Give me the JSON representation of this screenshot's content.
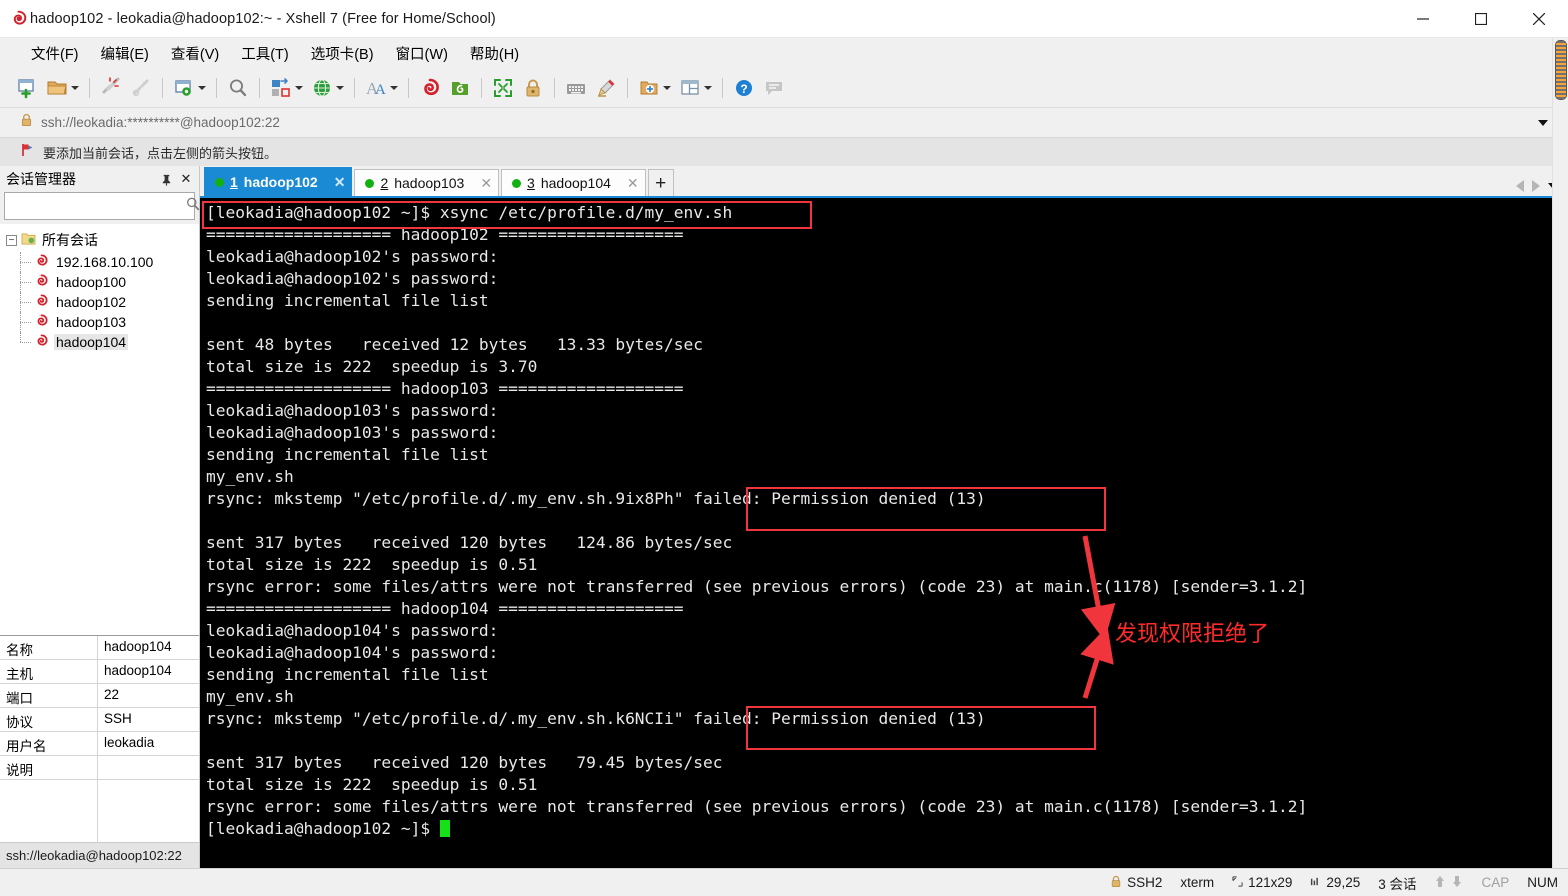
{
  "window": {
    "title": "hadoop102 - leokadia@hadoop102:~ - Xshell 7 (Free for Home/School)",
    "logo_icon": "xshell-logo-icon",
    "minimize_label": "—",
    "maximize_label": "▢",
    "close_label": "✕"
  },
  "menubar": {
    "items": [
      {
        "label": "文件(F)",
        "name": "menu-file"
      },
      {
        "label": "编辑(E)",
        "name": "menu-edit"
      },
      {
        "label": "查看(V)",
        "name": "menu-view"
      },
      {
        "label": "工具(T)",
        "name": "menu-tools"
      },
      {
        "label": "选项卡(B)",
        "name": "menu-tabs"
      },
      {
        "label": "窗口(W)",
        "name": "menu-window"
      },
      {
        "label": "帮助(H)",
        "name": "menu-help"
      }
    ]
  },
  "toolbar": {
    "buttons": [
      {
        "icon": "new-session-icon",
        "has_caret": false
      },
      {
        "icon": "open-folder-icon",
        "has_caret": true
      },
      {
        "icon": "disconnect-icon",
        "has_caret": false
      },
      {
        "icon": "reconnect-icon",
        "has_caret": false
      },
      {
        "icon": "session-properties-icon",
        "has_caret": true
      },
      {
        "icon": "find-icon",
        "has_caret": false
      },
      {
        "icon": "file-transfer-icon",
        "has_caret": true
      },
      {
        "icon": "globe-icon",
        "has_caret": true
      },
      {
        "icon": "font-icon",
        "has_caret": true
      },
      {
        "icon": "xshell-icon",
        "has_caret": false
      },
      {
        "icon": "xftp-icon",
        "has_caret": false
      },
      {
        "icon": "fullscreen-icon",
        "has_caret": false
      },
      {
        "icon": "lock-icon",
        "has_caret": false
      },
      {
        "icon": "keyboard-icon",
        "has_caret": false
      },
      {
        "icon": "highlight-pen-icon",
        "has_caret": false
      },
      {
        "icon": "add-folder-icon",
        "has_caret": true
      },
      {
        "icon": "layout-icon",
        "has_caret": true
      },
      {
        "icon": "help-icon",
        "has_caret": false
      },
      {
        "icon": "comment-icon",
        "has_caret": false
      }
    ]
  },
  "address_bar": {
    "lock_icon": "lock-icon",
    "url": "ssh://leokadia:**********@hadoop102:22",
    "dropdown_icon": "chevron-down-icon"
  },
  "notice_bar": {
    "flag_icon": "red-flag-icon",
    "text": "要添加当前会话，点击左侧的箭头按钮。"
  },
  "sidebar": {
    "title": "会话管理器",
    "pin_icon": "pin-icon",
    "close_icon": "close-icon",
    "search": {
      "value": "",
      "placeholder": "",
      "icon": "search-icon"
    },
    "tree": {
      "root_label": "所有会话",
      "root_icon": "folder-sessions-icon",
      "toggle": "−",
      "items": [
        {
          "label": "192.168.10.100",
          "icon": "session-icon",
          "selected": false
        },
        {
          "label": "hadoop100",
          "icon": "session-icon",
          "selected": false
        },
        {
          "label": "hadoop102",
          "icon": "session-icon",
          "selected": false
        },
        {
          "label": "hadoop103",
          "icon": "session-icon",
          "selected": false
        },
        {
          "label": "hadoop104",
          "icon": "session-icon",
          "selected": true
        }
      ]
    },
    "properties": [
      {
        "key": "名称",
        "value": "hadoop104"
      },
      {
        "key": "主机",
        "value": "hadoop104"
      },
      {
        "key": "端口",
        "value": "22"
      },
      {
        "key": "协议",
        "value": "SSH"
      },
      {
        "key": "用户名",
        "value": "leokadia"
      },
      {
        "key": "说明",
        "value": ""
      }
    ],
    "status": "ssh://leokadia@hadoop102:22"
  },
  "tabs": {
    "items": [
      {
        "num": "1",
        "label": "hadoop102",
        "active": true,
        "status_dot": "#12b112",
        "close_icon": "close-icon"
      },
      {
        "num": "2",
        "label": "hadoop103",
        "active": false,
        "status_dot": "#12b112",
        "close_icon": "close-icon"
      },
      {
        "num": "3",
        "label": "hadoop104",
        "active": false,
        "status_dot": "#12b112",
        "close_icon": "close-icon"
      }
    ],
    "add_label": "+",
    "nav_prev_icon": "triangle-left-icon",
    "nav_next_icon": "triangle-right-icon",
    "nav_list_icon": "chevron-down-icon"
  },
  "terminal": {
    "lines": [
      "[leokadia@hadoop102 ~]$ xsync /etc/profile.d/my_env.sh",
      "=================== hadoop102 ===================",
      "leokadia@hadoop102's password:",
      "leokadia@hadoop102's password:",
      "sending incremental file list",
      "",
      "sent 48 bytes   received 12 bytes   13.33 bytes/sec",
      "total size is 222  speedup is 3.70",
      "=================== hadoop103 ===================",
      "leokadia@hadoop103's password:",
      "leokadia@hadoop103's password:",
      "sending incremental file list",
      "my_env.sh",
      "rsync: mkstemp \"/etc/profile.d/.my_env.sh.9ix8Ph\" failed: Permission denied (13)",
      "",
      "sent 317 bytes   received 120 bytes   124.86 bytes/sec",
      "total size is 222  speedup is 0.51",
      "rsync error: some files/attrs were not transferred (see previous errors) (code 23) at main.c(1178) [sender=3.1.2]",
      "=================== hadoop104 ===================",
      "leokadia@hadoop104's password:",
      "leokadia@hadoop104's password:",
      "sending incremental file list",
      "my_env.sh",
      "rsync: mkstemp \"/etc/profile.d/.my_env.sh.k6NCIi\" failed: Permission denied (13)",
      "",
      "sent 317 bytes   received 120 bytes   79.45 bytes/sec",
      "total size is 222  speedup is 0.51",
      "rsync error: some files/attrs were not transferred (see previous errors) (code 23) at main.c(1178) [sender=3.1.2]",
      "[leokadia@hadoop102 ~]$ "
    ],
    "cursor_color": "#16e016",
    "background": "#000000",
    "foreground": "#e8e8e8"
  },
  "annotations": {
    "color": "#f0363c",
    "note_text": "发现权限拒绝了",
    "boxes": [
      {
        "name": "command-highlight-box"
      },
      {
        "name": "error-highlight-box-hadoop103"
      },
      {
        "name": "error-highlight-box-hadoop104"
      }
    ]
  },
  "statusbar": {
    "left": "ssh://leokadia@hadoop102:22",
    "lock_icon": "lock-icon",
    "protocol": "SSH2",
    "emulation": "xterm",
    "size_icon": "screen-size-icon",
    "size": "121x29",
    "pos_icon": "cursor-pos-icon",
    "position": "29,25",
    "sessions": "3 会话",
    "up_icon": "arrow-up-icon",
    "down_icon": "arrow-down-icon",
    "cap": "CAP",
    "num": "NUM"
  }
}
